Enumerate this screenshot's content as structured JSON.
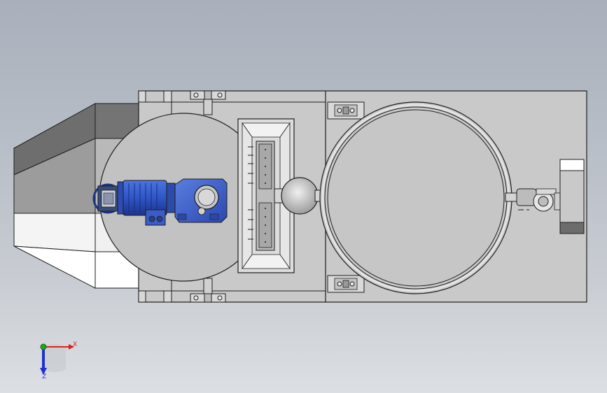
{
  "viewport": {
    "background_top": "#a9b0bb",
    "background_bottom": "#dcdfe3"
  },
  "colors": {
    "outline": "#1e1e1e",
    "panel": "#c7c7c7",
    "panel_shade": "#bdbdbd",
    "hopper_dark": "#6e6e6e",
    "hopper_mid": "#9a9a9a",
    "hopper_light": "#d2d2d2",
    "hopper_white": "#f6f6f6",
    "motor_blue": "#2f55c8",
    "motor_blue_dark": "#1c3488",
    "gearbox_blue": "#3c62d0",
    "axis_x": "#e02020",
    "axis_y": "#1aa81a",
    "axis_z": "#2030d0"
  },
  "triad": {
    "x_label": "X",
    "z_label": "Z"
  }
}
